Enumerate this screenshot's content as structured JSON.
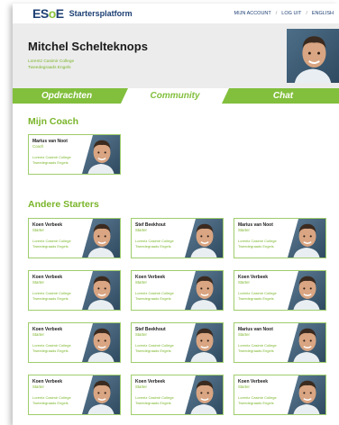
{
  "logo": {
    "text_pre": "ES",
    "text_o": "o",
    "text_post": "E"
  },
  "brand": "Startersplatform",
  "topnav": [
    "MIJN ACCOUNT",
    "LOG UIT",
    "ENGLISH"
  ],
  "user": {
    "name": "Mitchel Schelteknops",
    "school_line1": "Lorentz Casimir College",
    "school_line2": "Tweedegraads Engels"
  },
  "tabs": [
    {
      "label": "Opdrachten",
      "active": false
    },
    {
      "label": "Community",
      "active": true
    },
    {
      "label": "Chat",
      "active": false
    }
  ],
  "coach_section": {
    "title": "Mijn Coach",
    "card": {
      "name": "Marius van Noot",
      "role": "Coach",
      "school_line1": "Lorentz Casimir College",
      "school_line2": "Tweedegraads Engels"
    }
  },
  "starters_section": {
    "title": "Andere Starters",
    "cards": [
      {
        "name": "Koen Verbeek",
        "role": "Starter",
        "school_line1": "Lorentz Casimir College",
        "school_line2": "Tweedegraads Engels"
      },
      {
        "name": "Stef Beekhout",
        "role": "Starter",
        "school_line1": "Lorentz Casimir College",
        "school_line2": "Tweedegraads Engels"
      },
      {
        "name": "Marius van Noot",
        "role": "Starter",
        "school_line1": "Lorentz Casimir College",
        "school_line2": "Tweedegraads Engels"
      },
      {
        "name": "Koen Verbeek",
        "role": "Starter",
        "school_line1": "Lorentz Casimir College",
        "school_line2": "Tweedegraads Engels"
      },
      {
        "name": "Koen Verbeek",
        "role": "Starter",
        "school_line1": "Lorentz Casimir College",
        "school_line2": "Tweedegraads Engels"
      },
      {
        "name": "Koen Verbeek",
        "role": "Starter",
        "school_line1": "Lorentz Casimir College",
        "school_line2": "Tweedegraads Engels"
      },
      {
        "name": "Koen Verbeek",
        "role": "Starter",
        "school_line1": "Lorentz Casimir College",
        "school_line2": "Tweedegraads Engels"
      },
      {
        "name": "Stef Beekhout",
        "role": "Starter",
        "school_line1": "Lorentz Casimir College",
        "school_line2": "Tweedegraads Engels"
      },
      {
        "name": "Marius van Noot",
        "role": "Starter",
        "school_line1": "Lorentz Casimir College",
        "school_line2": "Tweedegraads Engels"
      },
      {
        "name": "Koen Verbeek",
        "role": "Starter",
        "school_line1": "Lorentz Casimir College",
        "school_line2": "Tweedegraads Engels"
      },
      {
        "name": "Koen Verbeek",
        "role": "Starter",
        "school_line1": "Lorentz Casimir College",
        "school_line2": "Tweedegraads Engels"
      },
      {
        "name": "Koen Verbeek",
        "role": "Starter",
        "school_line1": "Lorentz Casimir College",
        "school_line2": "Tweedegraads Engels"
      }
    ]
  },
  "colors": {
    "accent": "#82bf3c",
    "brand": "#1c3f73",
    "header_bg": "#ececec"
  },
  "icons": [
    "avatar-photo"
  ]
}
